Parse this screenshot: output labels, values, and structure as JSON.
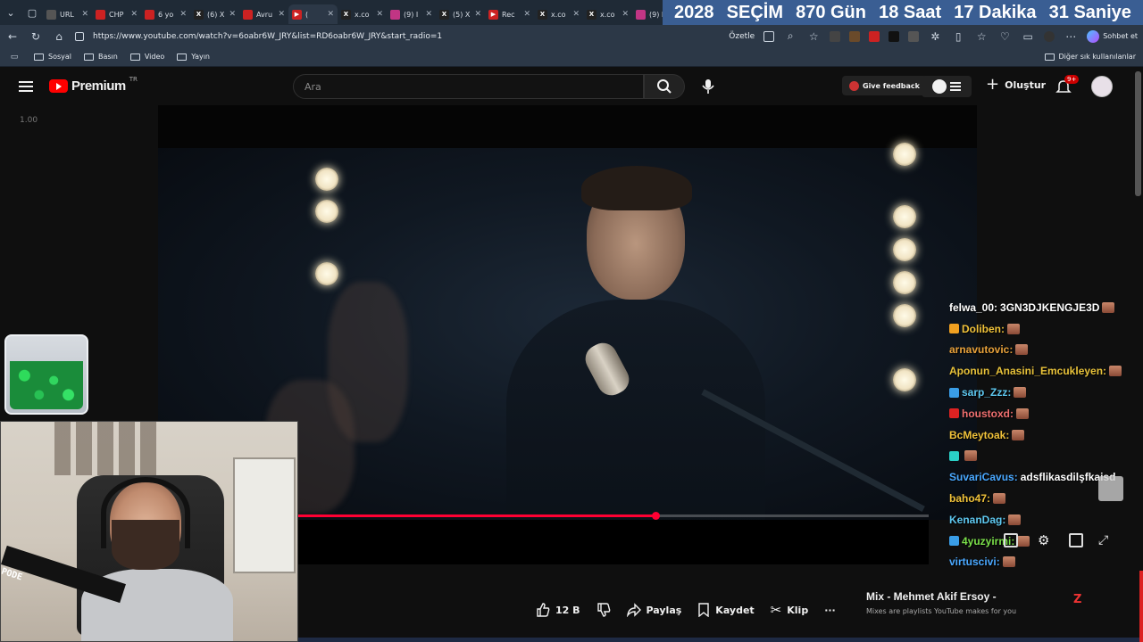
{
  "browser": {
    "tabs": [
      {
        "title": "URL",
        "fav_color": "#555555",
        "fav_glyph": ""
      },
      {
        "title": "CHP",
        "fav_color": "#cc2222",
        "fav_glyph": ""
      },
      {
        "title": "6 yo",
        "fav_color": "#cc2222",
        "fav_glyph": ""
      },
      {
        "title": "(6) X",
        "fav_color": "#222222",
        "fav_glyph": "X"
      },
      {
        "title": "Avru",
        "fav_color": "#cc2222",
        "fav_glyph": ""
      },
      {
        "title": "(",
        "fav_color": "#cc2222",
        "fav_glyph": "▶"
      },
      {
        "title": "x.co",
        "fav_color": "#222222",
        "fav_glyph": "X"
      },
      {
        "title": "(9) I",
        "fav_color": "#c13584",
        "fav_glyph": ""
      },
      {
        "title": "(5) X",
        "fav_color": "#222222",
        "fav_glyph": "X"
      },
      {
        "title": "Rec",
        "fav_color": "#cc2222",
        "fav_glyph": "▶"
      },
      {
        "title": "x.co",
        "fav_color": "#222222",
        "fav_glyph": "X"
      },
      {
        "title": "x.co",
        "fav_color": "#222222",
        "fav_glyph": "X"
      },
      {
        "title": "(9) I",
        "fav_color": "#c13584",
        "fav_glyph": ""
      }
    ],
    "countdown": {
      "year": "2028",
      "label": "SEÇİM",
      "days": "870 Gün",
      "hours": "18 Saat",
      "minutes": "17 Dakika",
      "seconds": "31 Saniye"
    },
    "url": "https://www.youtube.com/watch?v=6oabr6W_JRY&list=RD6oabr6W_JRY&start_radio=1",
    "summarize_label": "Özetle",
    "chat_label": "Sohbet et",
    "bookmarks": [
      "Sosyal",
      "Basın",
      "Video",
      "Yayın"
    ],
    "other_bookmarks": "Diğer sık kullanılanlar"
  },
  "youtube": {
    "logo_text": "Premium",
    "logo_region": "TR",
    "search_placeholder": "Ara",
    "feedback_label": "Give feedback",
    "create_label": "Oluştur",
    "notification_count": "9+",
    "speed": "1.00",
    "progress_fraction": 0.565
  },
  "chat": [
    {
      "user": "felwa_00:",
      "color": "#ffffff",
      "msg": "3GN3DJKENGJE3D",
      "emote": true,
      "badge": ""
    },
    {
      "user": "Doliben:",
      "color": "#f0c23a",
      "msg": "",
      "emote": true,
      "badge": "#f0a020"
    },
    {
      "user": "arnavutovic:",
      "color": "#e8a13a",
      "msg": "",
      "emote": true,
      "badge": ""
    },
    {
      "user": "Aponun_Anasini_Emcukleyen:",
      "color": "#e8c23a",
      "msg": "",
      "emote": true,
      "badge": ""
    },
    {
      "user": "sarp_Zzz:",
      "color": "#5ec8f0",
      "msg": "",
      "emote": true,
      "badge": "#3a9ee8"
    },
    {
      "user": "houstoxd:",
      "color": "#f07070",
      "msg": "",
      "emote": true,
      "badge": "#dd2222"
    },
    {
      "user": "BcMeytoak:",
      "color": "#f0c23a",
      "msg": "",
      "emote": true,
      "badge": ""
    },
    {
      "user": "",
      "color": "#2ad0c8",
      "msg": "",
      "emote": true,
      "badge": "#2ad0c8"
    },
    {
      "user": "SuvariCavus:",
      "color": "#4aa8ff",
      "msg": "adsflikasdilşfkaisd",
      "emote": false,
      "badge": ""
    },
    {
      "user": "baho47:",
      "color": "#f0c23a",
      "msg": "",
      "emote": true,
      "badge": ""
    },
    {
      "user": "KenanDag:",
      "color": "#5ec8f0",
      "msg": "",
      "emote": true,
      "badge": ""
    },
    {
      "user": "4yuzyirmi:",
      "color": "#7be04a",
      "msg": "",
      "emote": true,
      "badge": "#3a9ee8"
    },
    {
      "user": "virtuscivi:",
      "color": "#4aa8ff",
      "msg": "",
      "emote": true,
      "badge": ""
    }
  ],
  "actions": {
    "likes": "12 B",
    "share": "Paylaş",
    "save": "Kaydet",
    "clip": "Klip",
    "more": "···"
  },
  "mix": {
    "title": "Mix - Mehmet Akif Ersoy -",
    "subtitle": "Mixes are playlists YouTube makes for you"
  },
  "webcam": {
    "mic_label": "PODE"
  }
}
